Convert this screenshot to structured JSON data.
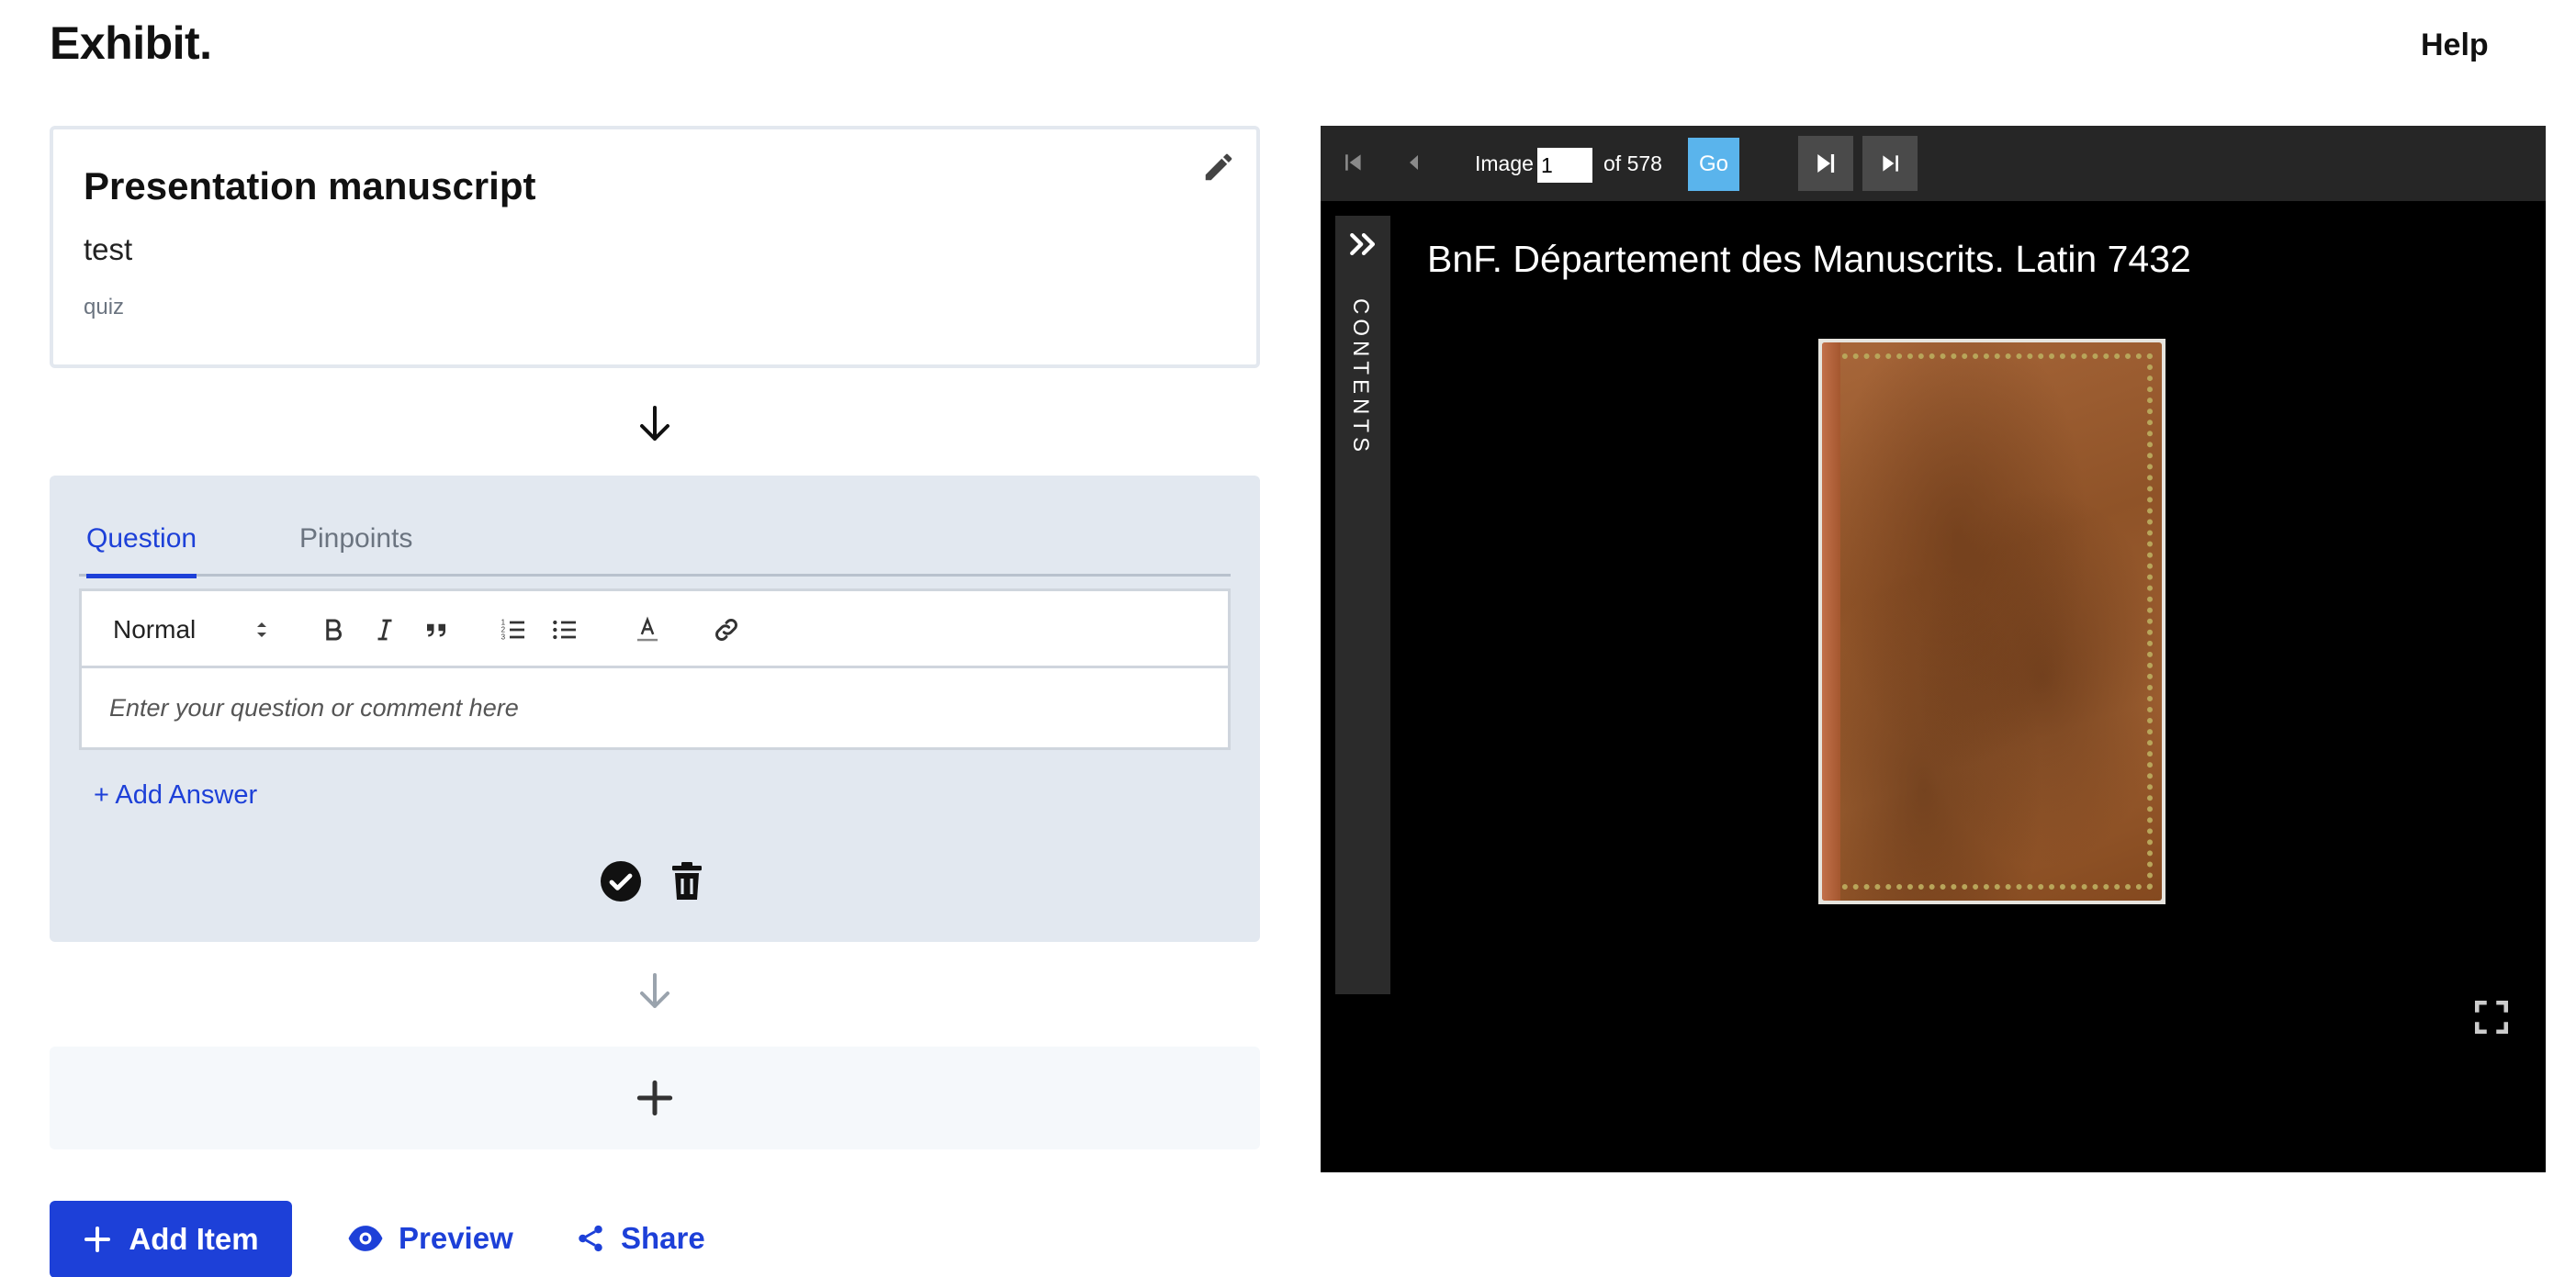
{
  "app": {
    "brand": "Exhibit.",
    "help_label": "Help"
  },
  "item_card": {
    "title": "Presentation manuscript",
    "description": "test",
    "type": "quiz"
  },
  "question_panel": {
    "tabs": [
      {
        "label": "Question",
        "active": true
      },
      {
        "label": "Pinpoints",
        "active": false
      }
    ],
    "editor": {
      "format_select": "Normal",
      "toolbar_icons": [
        "bold-icon",
        "italic-icon",
        "blockquote-icon",
        "ordered-list-icon",
        "bullet-list-icon",
        "text-color-icon",
        "link-icon"
      ],
      "placeholder": "Enter your question or comment here"
    },
    "add_answer_label": "+ Add Answer"
  },
  "actions": {
    "add_item_label": "Add Item",
    "preview_label": "Preview",
    "share_label": "Share"
  },
  "viewer": {
    "image_label": "Image",
    "current_image": "1",
    "of_label": "of 578",
    "go_label": "Go",
    "contents_label": "CONTENTS",
    "manuscript_title": "BnF. Département des Manuscrits. Latin 7432"
  },
  "colors": {
    "accent": "#1d40d8",
    "go_button": "#5ab4ec",
    "panel_bg": "#e2e8f0",
    "viewer_bg": "#000000"
  }
}
